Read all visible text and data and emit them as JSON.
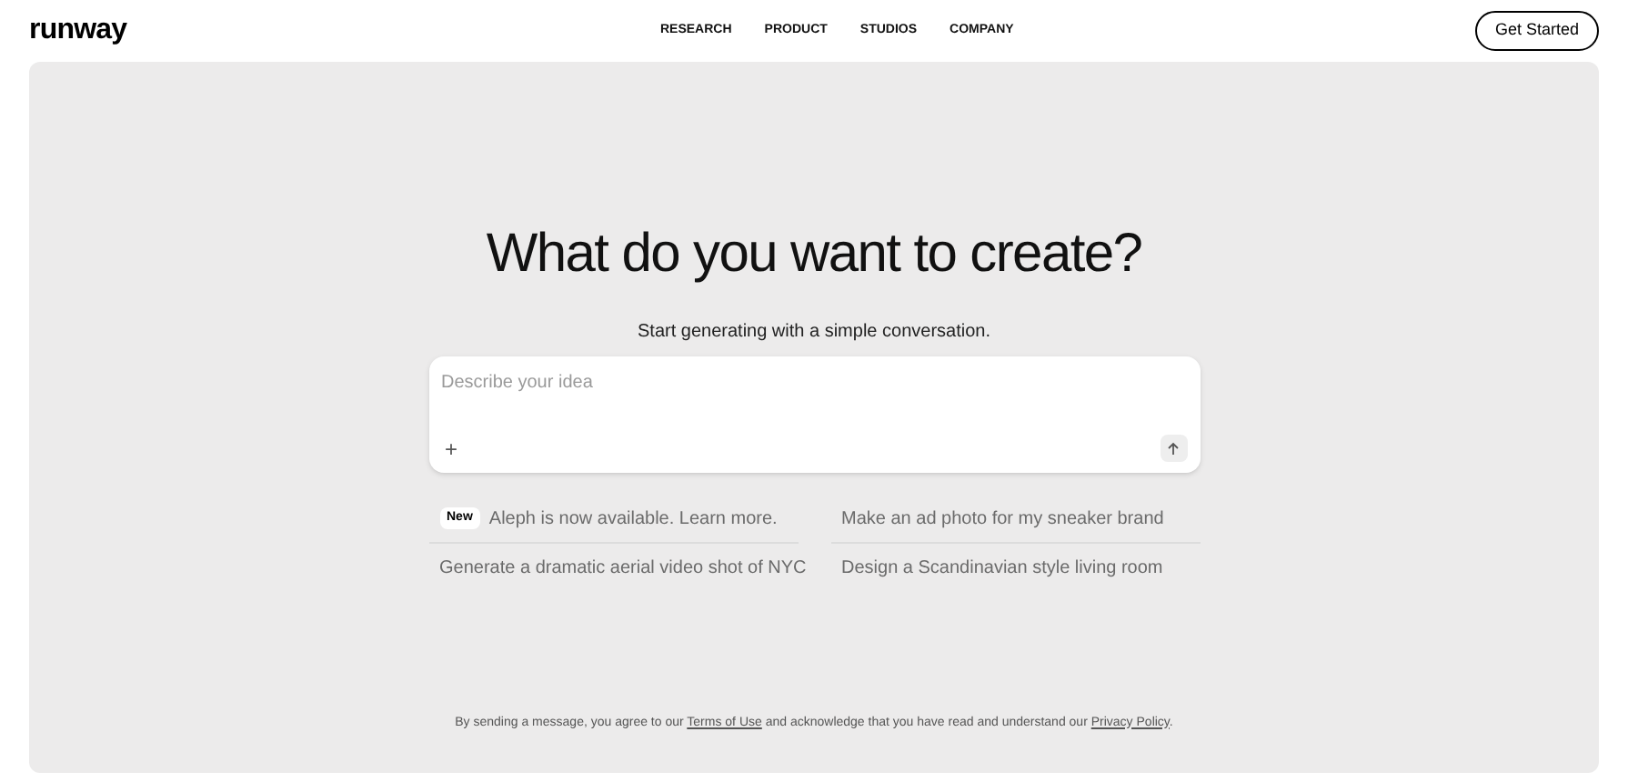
{
  "logo": "runway",
  "nav": [
    "RESEARCH",
    "PRODUCT",
    "STUDIOS",
    "COMPANY"
  ],
  "cta": "Get Started",
  "hero": {
    "title": "What do you want to create?",
    "subtitle": "Start generating with a simple conversation."
  },
  "prompt": {
    "placeholder": "Describe your idea",
    "add": "+"
  },
  "suggestions": [
    {
      "kind": "announcement",
      "badge": "New",
      "text": "Aleph is now available. Learn more."
    },
    {
      "kind": "prompt",
      "text": "Make an ad photo for my sneaker brand"
    },
    {
      "kind": "prompt",
      "text": "Generate a dramatic aerial video shot of NYC"
    },
    {
      "kind": "prompt",
      "text": "Design a Scandinavian style living room"
    }
  ],
  "disclaimer": {
    "before": "By sending a message, you agree to our",
    "link_1": "Terms of Use",
    "middle": "and acknowledge that you have read and understand our",
    "link_2": "Privacy Policy",
    "after": "."
  }
}
